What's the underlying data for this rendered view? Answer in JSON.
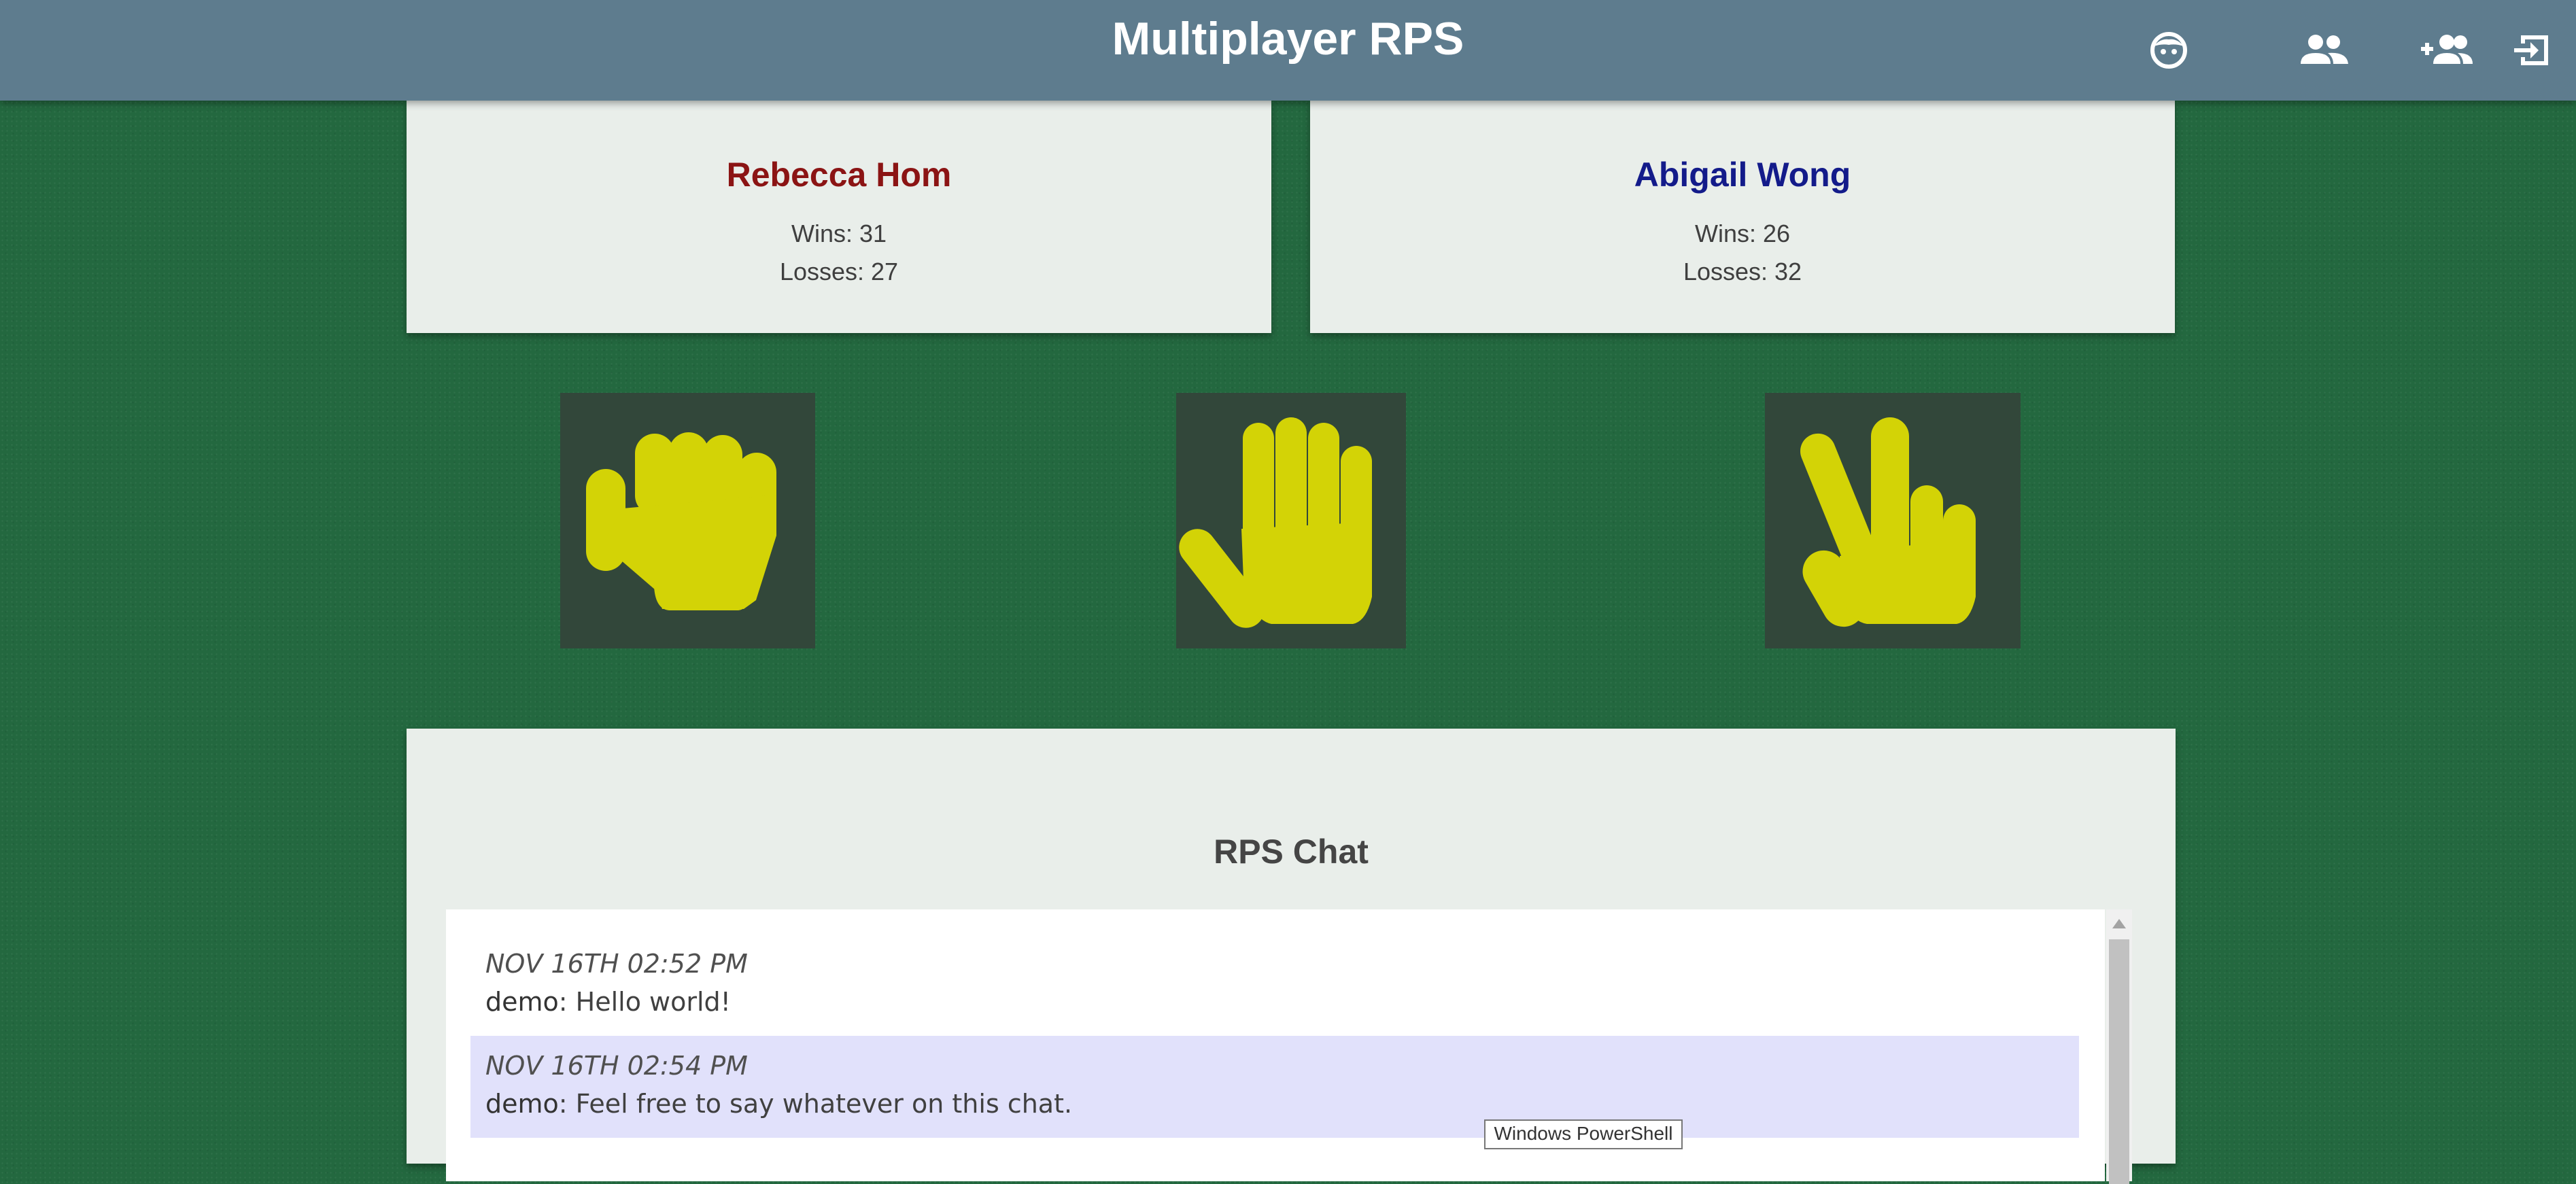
{
  "header": {
    "title": "Multiplayer RPS",
    "icons": [
      "profile-icon",
      "players-icon",
      "add-player-icon",
      "logout-icon"
    ]
  },
  "players": [
    {
      "name": "Rebecca Hom",
      "wins_label": "Wins: 31",
      "losses_label": "Losses: 27",
      "color": "#8b1414"
    },
    {
      "name": "Abigail Wong",
      "wins_label": "Wins: 26",
      "losses_label": "Losses: 32",
      "color": "#131b8a"
    }
  ],
  "choices": [
    "rock-icon",
    "paper-icon",
    "scissors-icon"
  ],
  "colors": {
    "accent": "#d3d306",
    "header": "#5e7c8e",
    "table": "#23683f"
  },
  "chat": {
    "title": "RPS Chat",
    "messages": [
      {
        "time": "NOV 16TH 02:52 PM",
        "user": "demo",
        "text": ": Hello world!"
      },
      {
        "time": "NOV 16TH 02:54 PM",
        "user": "demo",
        "text": ": Feel free to say whatever on this chat."
      }
    ]
  },
  "tooltip": "Windows PowerShell"
}
